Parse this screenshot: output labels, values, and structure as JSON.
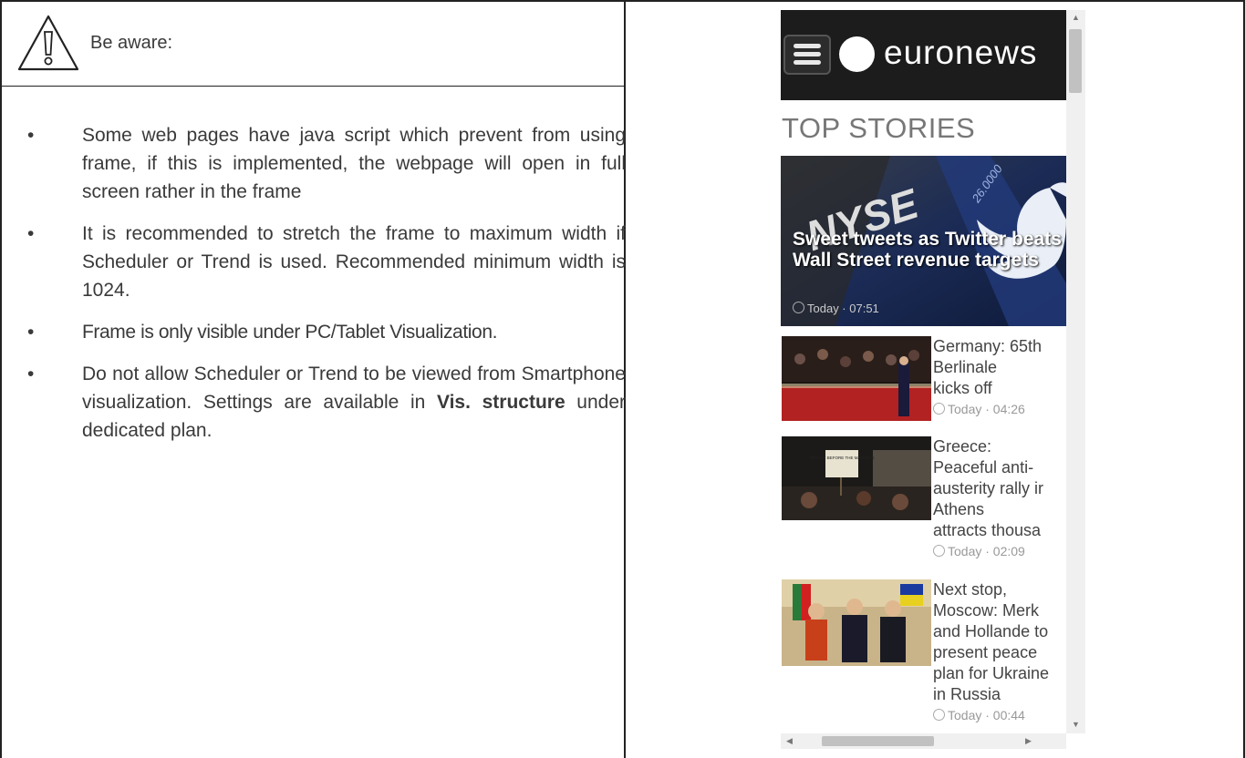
{
  "notice": {
    "heading": "Be aware:",
    "bullet_symbol": "•",
    "items": [
      "Some web pages have java script which prevent from using frame, if this is implemented, the webpage will open in full screen rather in the frame",
      "It is recommended to stretch the frame to maximum width if Scheduler or Trend is used. Recommended minimum width is 1024.",
      "Frame is only visible under PC/Tablet Visualization."
    ],
    "last_item": {
      "before": "Do not allow Scheduler or Trend to be viewed from Smartphone visualization. Settings are available in ",
      "bold": "Vis. structure",
      "after": " under dedicated plan."
    }
  },
  "embed": {
    "logo_text": "euronews",
    "section_title": "TOP STORIES",
    "hero": {
      "title": "Sweet tweets as Twitter beats Wall Street revenue targets",
      "time": "Today · 07:51",
      "image_text_1": "NYSE",
      "image_text_2": "26.0000"
    },
    "stories": [
      {
        "lines": [
          "Germany: 65th",
          "Berlinale",
          "kicks off"
        ],
        "time": "Today · 04:26"
      },
      {
        "lines": [
          "Greece:",
          "Peaceful anti-",
          "austerity rally ir",
          "Athens",
          "attracts thousa"
        ],
        "time": "Today · 02:09",
        "image_text": "PEOPLE BEFORE THE MARKETS"
      },
      {
        "lines": [
          "Next stop,",
          "Moscow: Merk",
          "and Hollande to",
          "present peace",
          "plan for Ukraine",
          "in Russia"
        ],
        "time": "Today · 00:44"
      }
    ]
  },
  "colors": {
    "text": "#3a3a3a",
    "header_bg": "#1c1c1c",
    "berlinale_red": "#b22222"
  }
}
